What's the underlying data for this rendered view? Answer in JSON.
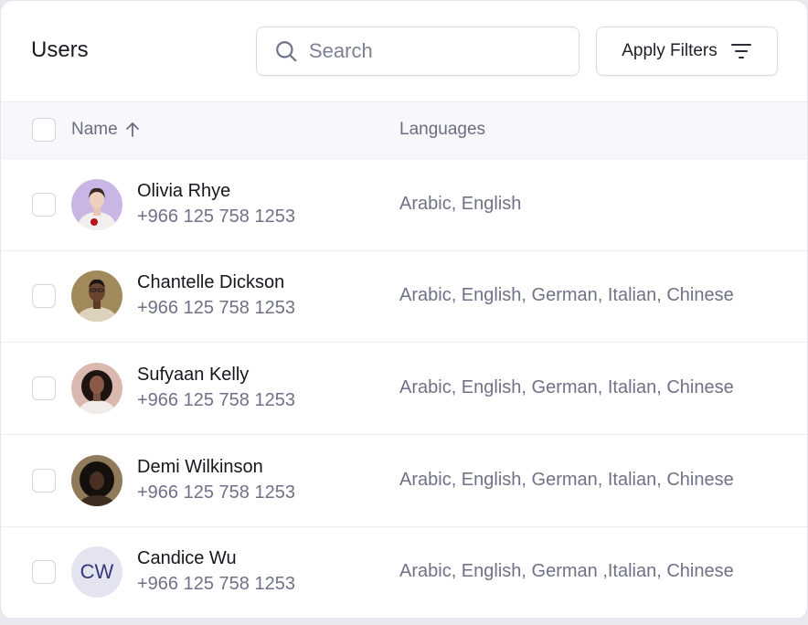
{
  "header": {
    "title": "Users",
    "search_placeholder": "Search",
    "filters_label": "Apply Filters"
  },
  "table": {
    "columns": {
      "name": "Name",
      "languages": "Languages"
    },
    "rows": [
      {
        "name": "Olivia Rhye",
        "phone": "+966 125 758 1253",
        "languages": "Arabic, English",
        "avatar": "photo"
      },
      {
        "name": "Chantelle Dickson",
        "phone": "+966 125 758 1253",
        "languages": "Arabic, English, German, Italian, Chinese",
        "avatar": "photo"
      },
      {
        "name": "Sufyaan Kelly",
        "phone": "+966 125 758 1253",
        "languages": "Arabic, English, German, Italian, Chinese",
        "avatar": "photo"
      },
      {
        "name": "Demi Wilkinson",
        "phone": "+966 125 758 1253",
        "languages": "Arabic, English, German, Italian, Chinese",
        "avatar": "photo"
      },
      {
        "name": "Candice Wu",
        "phone": "+966 125 758 1253",
        "languages": "Arabic, English, German ,Italian, Chinese",
        "avatar": "CW"
      }
    ]
  }
}
